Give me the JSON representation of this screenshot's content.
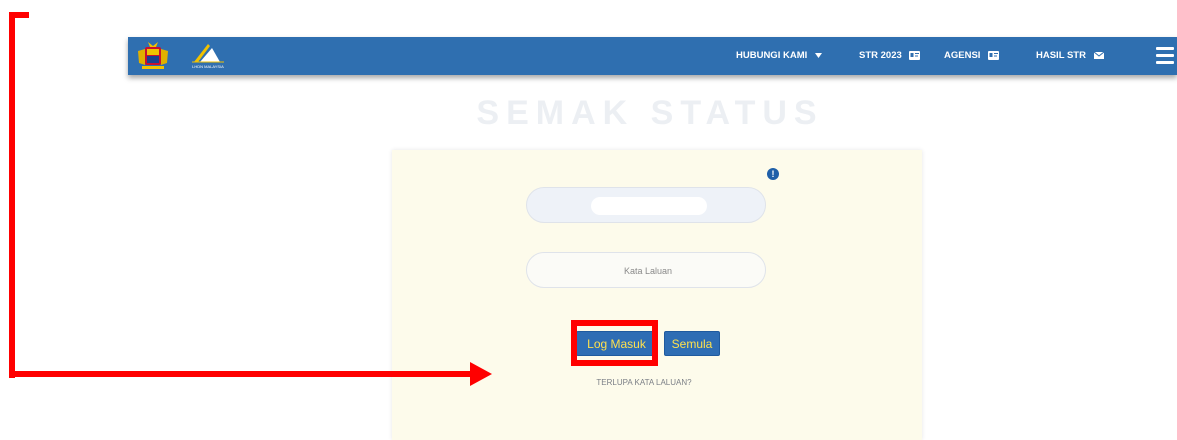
{
  "navbar": {
    "items": [
      {
        "label": "HUBUNGI KAMI",
        "icon": "caret-down-icon"
      },
      {
        "label": "STR 2023",
        "icon": "id-card-icon"
      },
      {
        "label": "AGENSI",
        "icon": "id-card-icon"
      },
      {
        "label": "HASIL STR",
        "icon": "envelope-icon"
      }
    ],
    "menu_icon": "hamburger-menu-icon",
    "logos": [
      "malaysia-coat-of-arms",
      "lhdn-malaysia-logo"
    ],
    "lhdn_logo_text": "LHDN MALAYSIA",
    "color": "#2f6fb0"
  },
  "page": {
    "title": "SEMAK STATUS"
  },
  "login_form": {
    "info_icon": "!",
    "username_placeholder": "",
    "username_value": "",
    "password_placeholder": "Kata Laluan",
    "login_button": "Log Masuk",
    "reset_button": "Semula",
    "forgot_password_link": "TERLUPA KATA LALUAN?",
    "button_color": "#2e6db4",
    "button_text_color": "#ffe14d",
    "card_color": "#fdfbeb"
  },
  "annotation": {
    "color": "#ff0000",
    "target": "Log Masuk"
  }
}
